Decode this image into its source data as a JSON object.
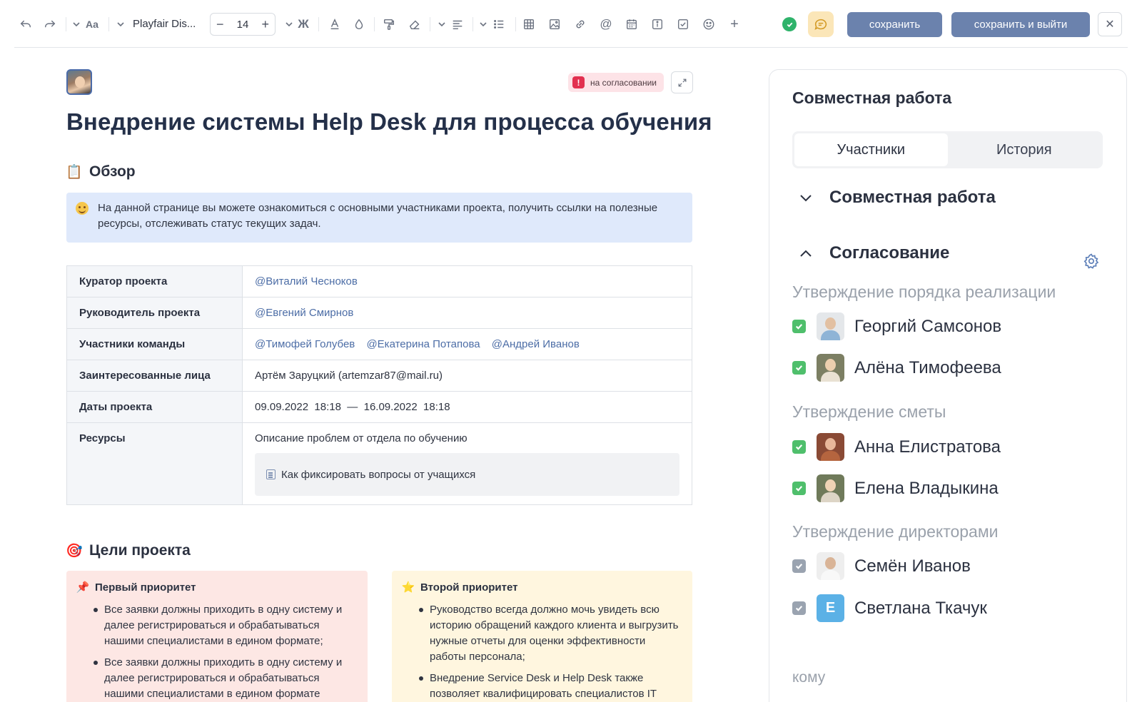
{
  "toolbar": {
    "font_name": "Playfair Dis...",
    "font_size": "14",
    "minus": "−",
    "plus": "+",
    "save_label": "сохранить",
    "save_exit_label": "сохранить и выйти",
    "close": "✕",
    "icons": [
      "undo-icon",
      "redo-icon",
      "text-style-icon",
      "font-family-icon",
      "bold-icon",
      "text-color-icon",
      "highlight-icon",
      "format-painter-icon",
      "eraser-icon",
      "align-icon",
      "list-icon",
      "table-icon",
      "image-icon",
      "link-icon",
      "mention-icon",
      "calendar-icon",
      "info-icon",
      "checkbox-icon",
      "emoji-icon",
      "add-icon",
      "status-ok-icon",
      "comments-icon"
    ],
    "colors": {
      "primary_button": "#6b82ad",
      "status_ok": "#2fb36b",
      "comments_bg": "#fbe6b8"
    }
  },
  "document": {
    "status_badge": "на согласовании",
    "title": "Внедрение системы Help Desk для процесса обучения",
    "overview": {
      "heading": "Обзор",
      "callout": "На данной странице вы можете ознакомиться с основными участниками проекта, получить ссылки на полезные ресурсы, отслеживать статус текущих задач."
    },
    "table": {
      "curator": {
        "key": "Куратор проекта",
        "value": "@Виталий Чесноков"
      },
      "lead": {
        "key": "Руководитель проекта",
        "value": "@Евгений Смирнов"
      },
      "team": {
        "key": "Участники команды",
        "members": [
          "@Тимофей Голубев",
          "@Екатерина Потапова",
          "@Андрей Иванов"
        ]
      },
      "stakeholders": {
        "key": "Заинтересованные лица",
        "value": "Артём Заруцкий (artemzar87@mail.ru)"
      },
      "dates": {
        "key": "Даты проекта",
        "value": "09.09.2022  18:18  —  16.09.2022  18:18"
      },
      "resources": {
        "key": "Ресурсы",
        "value": "Описание проблем от отдела по обучению",
        "link": "Как фиксировать вопросы от учащихся"
      }
    },
    "goals": {
      "heading": "Цели проекта",
      "first": {
        "title": "Первый приоритет",
        "items": [
          "Все заявки должны приходить в одну систему и далее регистрироваться и обрабатываться нашими специалистами в едином формате;",
          "Все заявки должны приходить в одну систему и далее регистрироваться и обрабатываться нашими специалистами в едином формате"
        ]
      },
      "second": {
        "title": "Второй приоритет",
        "items": [
          "Руководство всегда должно мочь увидеть всю историю обращений каждого клиента и выгрузить нужные отчеты для оценки эффективности работы персонала;",
          "Внедрение Service Desk и Help Desk также позволяет квалифицировать специалистов IT"
        ]
      }
    }
  },
  "panel": {
    "title": "Совместная работа",
    "tabs": [
      "Участники",
      "История"
    ],
    "active_tab": "Участники",
    "accordion_collab": "Совместная работа",
    "accordion_approval": "Согласование",
    "groups": [
      {
        "label": "Утверждение порядка реализации",
        "people": [
          {
            "name": "Георгий Самсонов",
            "checked": true
          },
          {
            "name": "Алёна Тимофеева",
            "checked": true
          }
        ]
      },
      {
        "label": "Утверждение сметы",
        "people": [
          {
            "name": "Анна Елистратова",
            "checked": true
          },
          {
            "name": "Елена Владыкина",
            "checked": true
          }
        ]
      },
      {
        "label": "Утверждение директорами",
        "people": [
          {
            "name": "Семён Иванов",
            "checked": false
          },
          {
            "name": "Светлана Ткачук",
            "checked": false,
            "avatar_letter": "Е"
          }
        ]
      }
    ],
    "to_label": "кому"
  }
}
